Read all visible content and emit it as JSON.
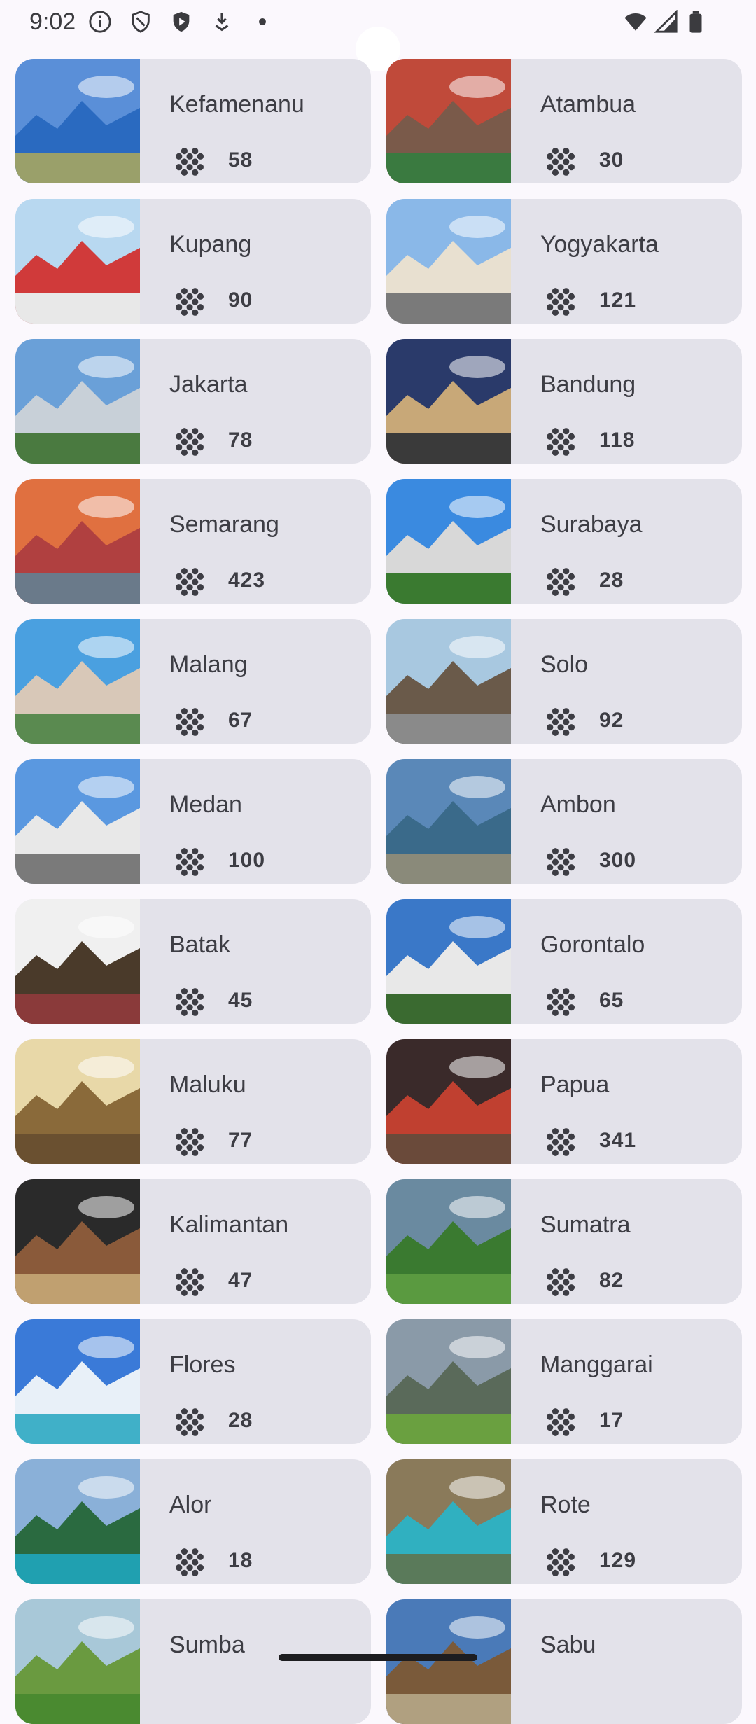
{
  "status_bar": {
    "time": "9:02",
    "left_icons": [
      "info-icon",
      "shield-icon",
      "play-protect-icon",
      "download-icon",
      "dot-icon"
    ],
    "right_icons": [
      "wifi-icon",
      "signal-icon",
      "battery-icon"
    ]
  },
  "count_icon": "dots-grid-icon",
  "cities": [
    {
      "name": "Kefamenanu",
      "count": "58"
    },
    {
      "name": "Atambua",
      "count": "30"
    },
    {
      "name": "Kupang",
      "count": "90"
    },
    {
      "name": "Yogyakarta",
      "count": "121"
    },
    {
      "name": "Jakarta",
      "count": "78"
    },
    {
      "name": "Bandung",
      "count": "118"
    },
    {
      "name": "Semarang",
      "count": "423"
    },
    {
      "name": "Surabaya",
      "count": "28"
    },
    {
      "name": "Malang",
      "count": "67"
    },
    {
      "name": "Solo",
      "count": "92"
    },
    {
      "name": "Medan",
      "count": "100"
    },
    {
      "name": "Ambon",
      "count": "300"
    },
    {
      "name": "Batak",
      "count": "45"
    },
    {
      "name": "Gorontalo",
      "count": "65"
    },
    {
      "name": "Maluku",
      "count": "77"
    },
    {
      "name": "Papua",
      "count": "341"
    },
    {
      "name": "Kalimantan",
      "count": "47"
    },
    {
      "name": "Sumatra",
      "count": "82"
    },
    {
      "name": "Flores",
      "count": "28"
    },
    {
      "name": "Manggarai",
      "count": "17"
    },
    {
      "name": "Alor",
      "count": "18"
    },
    {
      "name": "Rote",
      "count": "129"
    },
    {
      "name": "Sumba",
      "count": ""
    },
    {
      "name": "Sabu",
      "count": ""
    }
  ]
}
